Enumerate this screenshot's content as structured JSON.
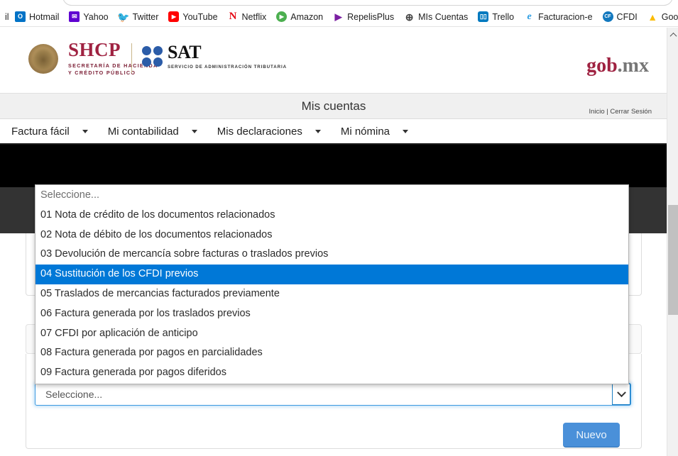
{
  "browser": {
    "bookmarks": [
      {
        "label": "il",
        "icon": "partial-bookmark-icon",
        "glyph": "",
        "cls": "partial-left"
      },
      {
        "label": "Hotmail",
        "icon": "hotmail-icon",
        "glyph": "O"
      },
      {
        "label": "Yahoo",
        "icon": "yahoo-icon",
        "glyph": "✉"
      },
      {
        "label": "Twitter",
        "icon": "twitter-icon",
        "glyph": "🐦"
      },
      {
        "label": "YouTube",
        "icon": "youtube-icon",
        "glyph": "▶"
      },
      {
        "label": "Netflix",
        "icon": "netflix-icon",
        "glyph": "N"
      },
      {
        "label": "Amazon",
        "icon": "amazon-icon",
        "glyph": "▶"
      },
      {
        "label": "RepelisPlus",
        "icon": "repelisplus-icon",
        "glyph": "▶"
      },
      {
        "label": "MIs Cuentas",
        "icon": "mis-cuentas-globe-icon",
        "glyph": "⊕"
      },
      {
        "label": "Trello",
        "icon": "trello-icon",
        "glyph": "▯▯"
      },
      {
        "label": "Facturacion-e",
        "icon": "facturacion-e-icon",
        "glyph": "e"
      },
      {
        "label": "CFDI",
        "icon": "cfdi-icon",
        "glyph": "CF"
      },
      {
        "label": "Google Ads",
        "icon": "google-ads-icon",
        "glyph": "▲"
      }
    ],
    "scrollbar": {
      "up_arrow": "scroll-up-arrow"
    }
  },
  "site_header": {
    "shcp_acronym": "SHCP",
    "shcp_subtitle_line1": "SECRETARÍA DE HACIENDA",
    "shcp_subtitle_line2": "Y CRÉDITO PÚBLICO",
    "sat_acronym": "SAT",
    "sat_subtitle": "SERVICIO DE ADMINISTRACIÓN TRIBUTARIA",
    "gob_part1": "gob",
    "gob_part2": ".mx"
  },
  "title_bar": {
    "title": "Mis cuentas",
    "home_link": "Inicio",
    "separator": "|",
    "logout_link": "Cerrar Sesión"
  },
  "nav": {
    "items": [
      {
        "label": "Factura fácil"
      },
      {
        "label": "Mi contabilidad"
      },
      {
        "label": "Mis declaraciones"
      },
      {
        "label": "Mi nómina"
      }
    ]
  },
  "form": {
    "select_value": "Seleccione...",
    "new_button": "Nuevo"
  },
  "dropdown": {
    "selected_index": 4,
    "options": [
      {
        "label": "Seleccione...",
        "placeholder": true
      },
      {
        "label": "01 Nota de crédito de los documentos relacionados"
      },
      {
        "label": "02 Nota de débito de los documentos relacionados"
      },
      {
        "label": "03 Devolución de mercancía sobre facturas o traslados previos"
      },
      {
        "label": "04 Sustitución de los CFDI previos"
      },
      {
        "label": "05 Traslados de mercancias facturados previamente"
      },
      {
        "label": "06 Factura generada por los traslados previos"
      },
      {
        "label": "07 CFDI por aplicación de anticipo"
      },
      {
        "label": "08 Factura generada por pagos en parcialidades"
      },
      {
        "label": "09 Factura generada por pagos diferidos"
      }
    ]
  },
  "colors": {
    "highlight_blue": "#0078D7",
    "shcp_red": "#9F2241",
    "sat_blue": "#2B5CA8",
    "button_blue": "#4A90D9"
  }
}
